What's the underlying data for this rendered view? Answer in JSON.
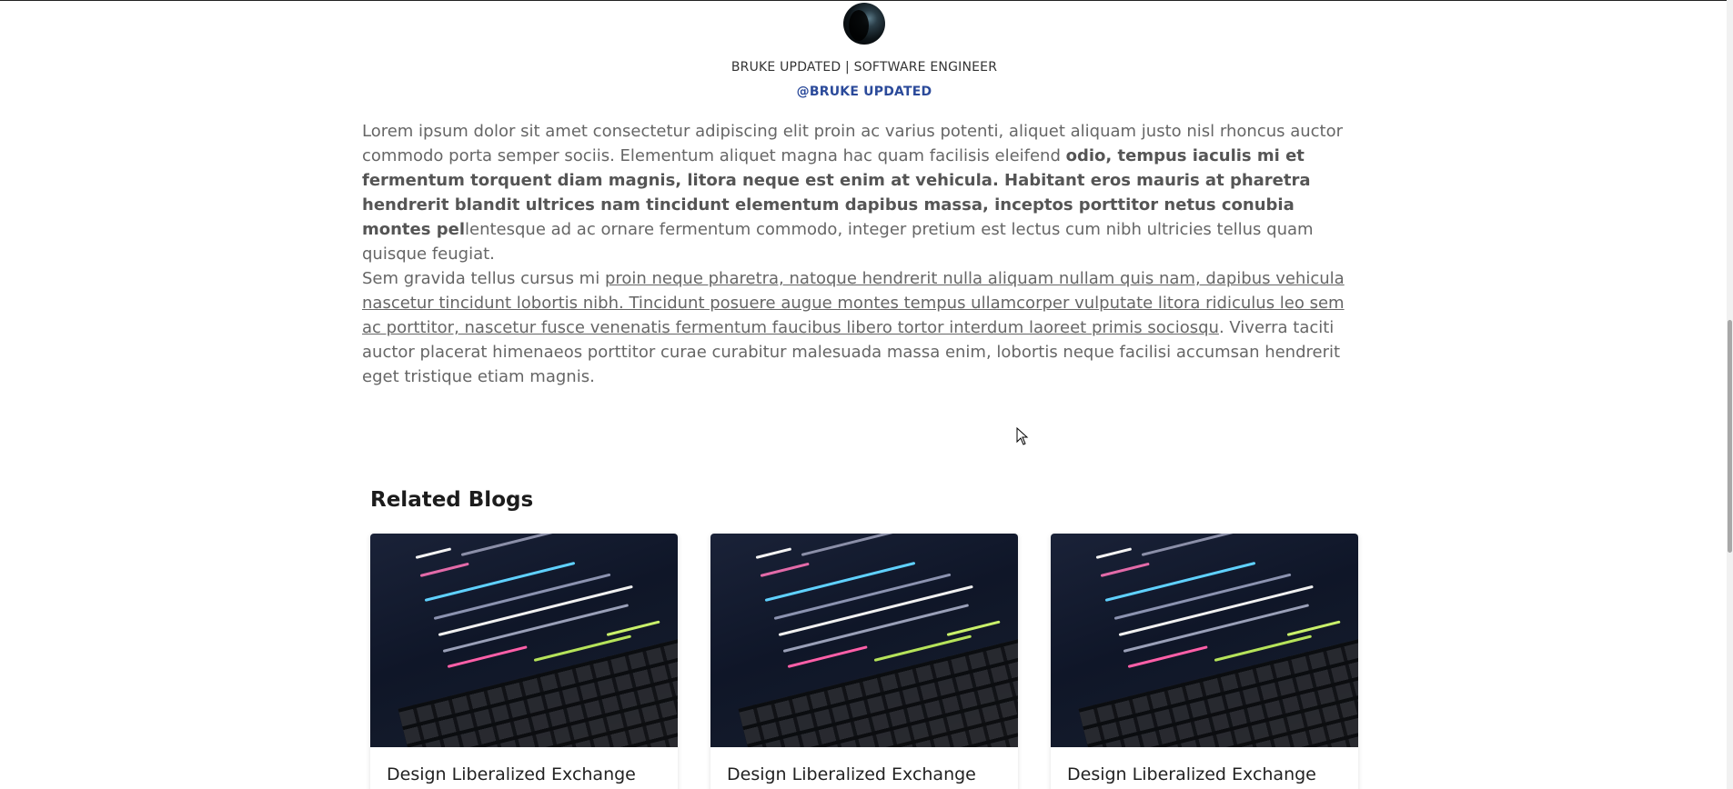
{
  "author": {
    "avatar_icon": "profile-avatar-icon",
    "name_role": "BRUKE UPDATED | SOFTWARE ENGINEER",
    "handle": "@BRUKE UPDATED"
  },
  "article": {
    "p1_plain": "Lorem ipsum dolor sit amet consectetur adipiscing elit proin ac varius potenti, aliquet aliquam justo nisl rhoncus auctor commodo porta semper sociis. Elementum aliquet magna hac quam facilisis eleifend ",
    "p1_bold": "odio, tempus iaculis mi et fermentum torquent diam magnis, litora neque est enim at vehicula. Habitant eros mauris at pharetra hendrerit blandit ultrices nam tincidunt elementum dapibus massa, inceptos porttitor netus conubia montes pel",
    "p1_tail": "lentesque ad ac ornare fermentum commodo, integer pretium est lectus cum nibh ultricies tellus quam quisque feugiat.",
    "p2_lead": "Sem gravida tellus cursus mi ",
    "p2_link": "proin neque pharetra, natoque hendrerit nulla aliquam nullam quis nam, dapibus vehicula nascetur tincidunt lobortis nibh. Tincidunt posuere augue montes tempus ullamcorper vulputate litora ridiculus leo sem ac porttitor, nascetur fusce venenatis fermentum faucibus libero tortor interdum laoreet primis sociosqu",
    "p2_tail": ". Viverra taciti auctor placerat himenaeos porttitor curae curabitur malesuada massa enim, lobortis neque facilisi accumsan hendrerit eget tristique etiam magnis."
  },
  "related": {
    "heading": "Related Blogs",
    "cards": [
      {
        "title": "Design Liberalized Exchange"
      },
      {
        "title": "Design Liberalized Exchange"
      },
      {
        "title": "Design Liberalized Exchange"
      }
    ]
  },
  "colors": {
    "handle": "#2b4a9a",
    "body_text": "#666666",
    "heading": "#1c1c1c"
  }
}
